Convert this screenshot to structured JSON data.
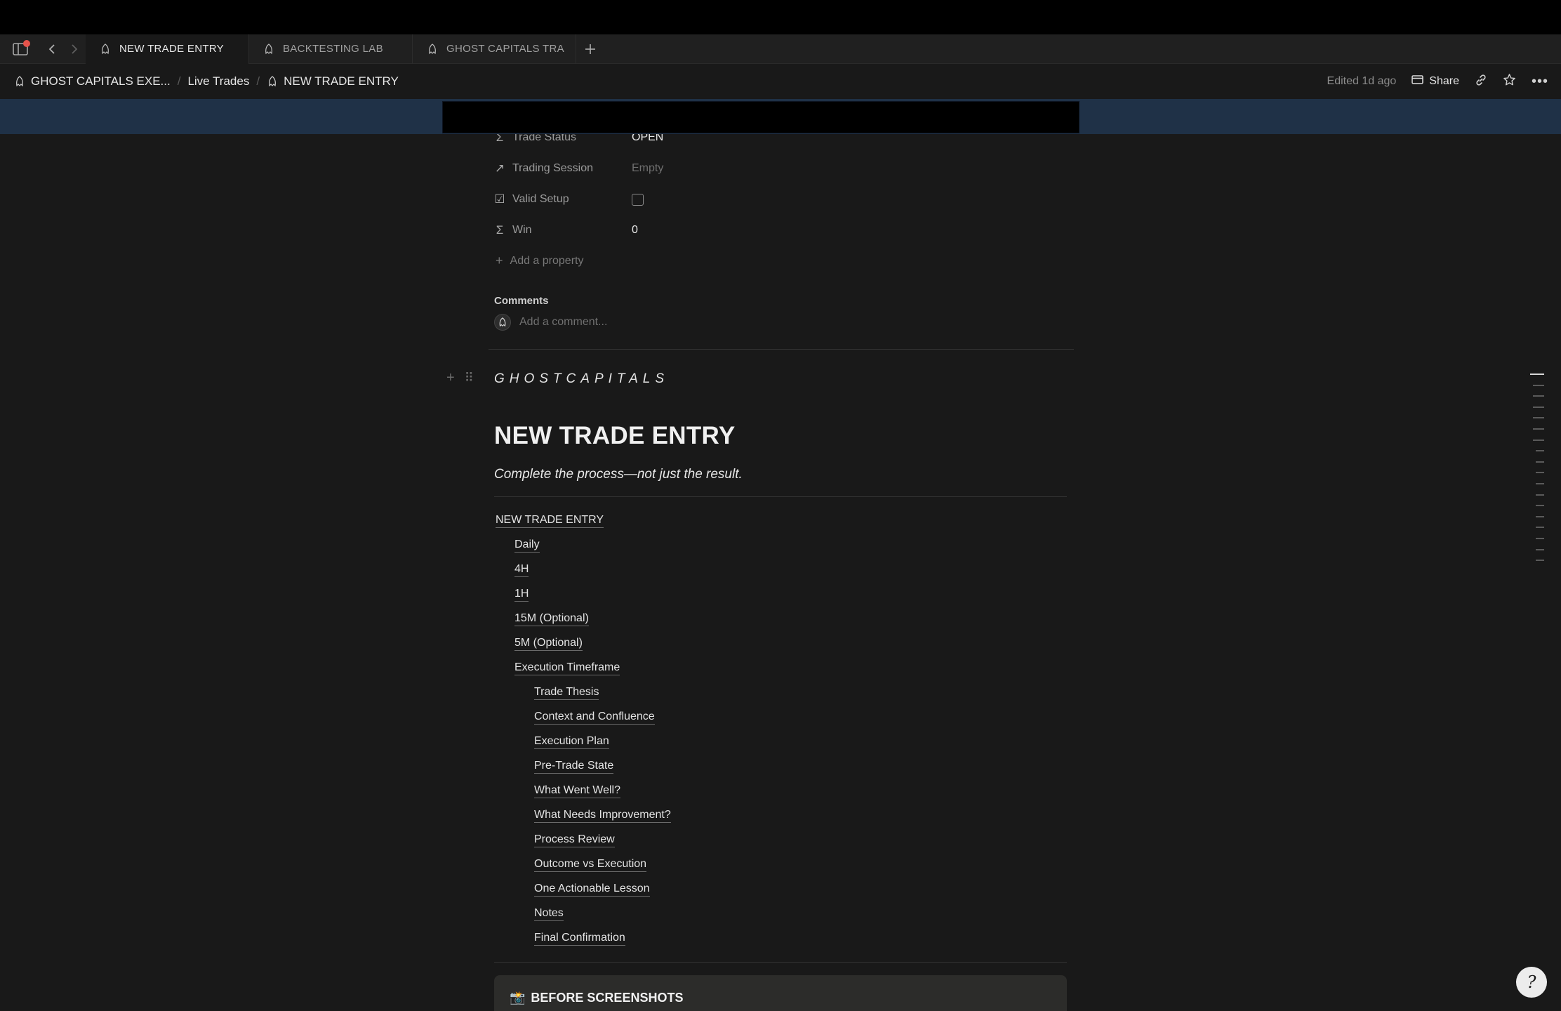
{
  "browser": {
    "notification_dot_color": "#e5534b",
    "tabs": [
      {
        "label": "NEW TRADE ENTRY",
        "active": true
      },
      {
        "label": "BACKTESTING LAB",
        "active": false
      },
      {
        "label": "GHOST CAPITALS TRA",
        "active": false
      }
    ],
    "new_tab_icon": "plus-icon"
  },
  "breadcrumb": {
    "items": [
      "GHOST CAPITALS EXE...",
      "Live Trades",
      "NEW TRADE ENTRY"
    ],
    "edited": "Edited 1d ago",
    "share_label": "Share"
  },
  "properties": [
    {
      "icon": "sigma-icon",
      "glyph": "Σ",
      "name": "Trade Status",
      "value": "OPEN",
      "empty": false
    },
    {
      "icon": "relation-arrow-icon",
      "glyph": "↗",
      "name": "Trading Session",
      "value": "Empty",
      "empty": true
    },
    {
      "icon": "checkbox-property-icon",
      "glyph": "☑",
      "name": "Valid Setup",
      "value": "",
      "empty": false
    },
    {
      "icon": "sigma-icon",
      "glyph": "Σ",
      "name": "Win",
      "value": "0",
      "empty": false
    }
  ],
  "add_property_label": "Add a property",
  "comments": {
    "label": "Comments",
    "placeholder": "Add a comment..."
  },
  "page": {
    "brand": "GHOSTCAPITALS",
    "title": "NEW TRADE ENTRY",
    "subtitle": "Complete the process—not just the result."
  },
  "toc": [
    {
      "label": "NEW TRADE ENTRY",
      "level": 0
    },
    {
      "label": "Daily",
      "level": 1
    },
    {
      "label": "4H",
      "level": 1
    },
    {
      "label": "1H",
      "level": 1
    },
    {
      "label": "15M (Optional)",
      "level": 1
    },
    {
      "label": "5M (Optional)",
      "level": 1
    },
    {
      "label": "Execution Timeframe",
      "level": 1
    },
    {
      "label": "Trade Thesis",
      "level": 2
    },
    {
      "label": "Context and Confluence",
      "level": 2
    },
    {
      "label": "Execution Plan",
      "level": 2
    },
    {
      "label": "Pre-Trade State",
      "level": 2
    },
    {
      "label": "What Went Well?",
      "level": 2
    },
    {
      "label": "What Needs Improvement?",
      "level": 2
    },
    {
      "label": "Process Review",
      "level": 2
    },
    {
      "label": "Outcome vs Execution",
      "level": 2
    },
    {
      "label": "One Actionable Lesson",
      "level": 2
    },
    {
      "label": "Notes",
      "level": 2
    },
    {
      "label": "Final Confirmation",
      "level": 2
    }
  ],
  "callout": {
    "icon": "camera-flash-emoji",
    "emoji": "📸",
    "label": "BEFORE SCREENSHOTS"
  },
  "help_glyph": "?"
}
